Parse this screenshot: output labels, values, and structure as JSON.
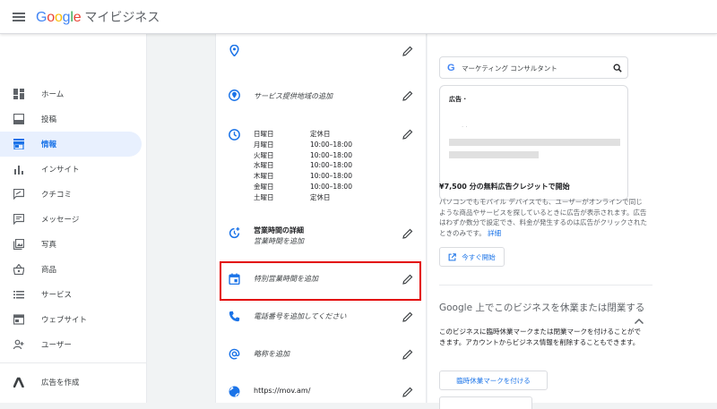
{
  "header": {
    "brand_google": [
      "G",
      "o",
      "o",
      "g",
      "l",
      "e"
    ],
    "brand_suffix": "マイビジネス"
  },
  "sidebar": {
    "items": [
      {
        "label": "ホーム",
        "icon": "dashboard-icon"
      },
      {
        "label": "投稿",
        "icon": "post-icon"
      },
      {
        "label": "情報",
        "icon": "storefront-icon",
        "active": true
      },
      {
        "label": "インサイト",
        "icon": "bar-chart-icon"
      },
      {
        "label": "クチコミ",
        "icon": "review-icon"
      },
      {
        "label": "メッセージ",
        "icon": "message-icon"
      },
      {
        "label": "写真",
        "icon": "photo-icon"
      },
      {
        "label": "商品",
        "icon": "basket-icon"
      },
      {
        "label": "サービス",
        "icon": "list-icon"
      },
      {
        "label": "ウェブサイト",
        "icon": "website-icon"
      },
      {
        "label": "ユーザー",
        "icon": "add-user-icon"
      },
      {
        "label": "広告を作成",
        "icon": "google-ads-icon"
      }
    ]
  },
  "info": {
    "service_area": "サービス提供地域の追加",
    "hours": [
      {
        "day": "日曜日",
        "time": "定休日"
      },
      {
        "day": "月曜日",
        "time": "10:00–18:00"
      },
      {
        "day": "火曜日",
        "time": "10:00–18:00"
      },
      {
        "day": "水曜日",
        "time": "10:00–18:00"
      },
      {
        "day": "木曜日",
        "time": "10:00–18:00"
      },
      {
        "day": "金曜日",
        "time": "10:00–18:00"
      },
      {
        "day": "土曜日",
        "time": "定休日"
      }
    ],
    "more_hours_title": "営業時間の詳細",
    "more_hours_sub": "営業時間を追加",
    "special_hours": "特別営業時間を追加",
    "phone": "電話番号を追加してください",
    "short_name": "略称を追加",
    "website": "https://mov.am/"
  },
  "ads": {
    "search_query": "マーケティング コンサルタント",
    "ad_label": "広告 ·",
    "ad_dots": "· ·",
    "credit_title": "¥7,500 分の無料広告クレジットで開始",
    "credit_desc": "パソコンでもモバイル デバイスでも、ユーザーがオンラインで同じような商品やサービスを探しているときに広告が表示されます。広告はわずか数分で設定でき、料金が発生するのは広告がクリックされたときのみです。",
    "details_link": "詳細",
    "start_button": "今すぐ開始"
  },
  "close_section": {
    "title": "Google 上でこのビジネスを休業または閉業する",
    "desc": "このビジネスに臨時休業マークまたは閉業マークを付けることができます。アカウントからビジネス情報を削除することもできます。",
    "temp_close_button": "臨時休業マークを付ける"
  },
  "colors": {
    "accent": "#1a73e8",
    "highlight_border": "#e30000",
    "active_bg": "#e8f0fe"
  }
}
